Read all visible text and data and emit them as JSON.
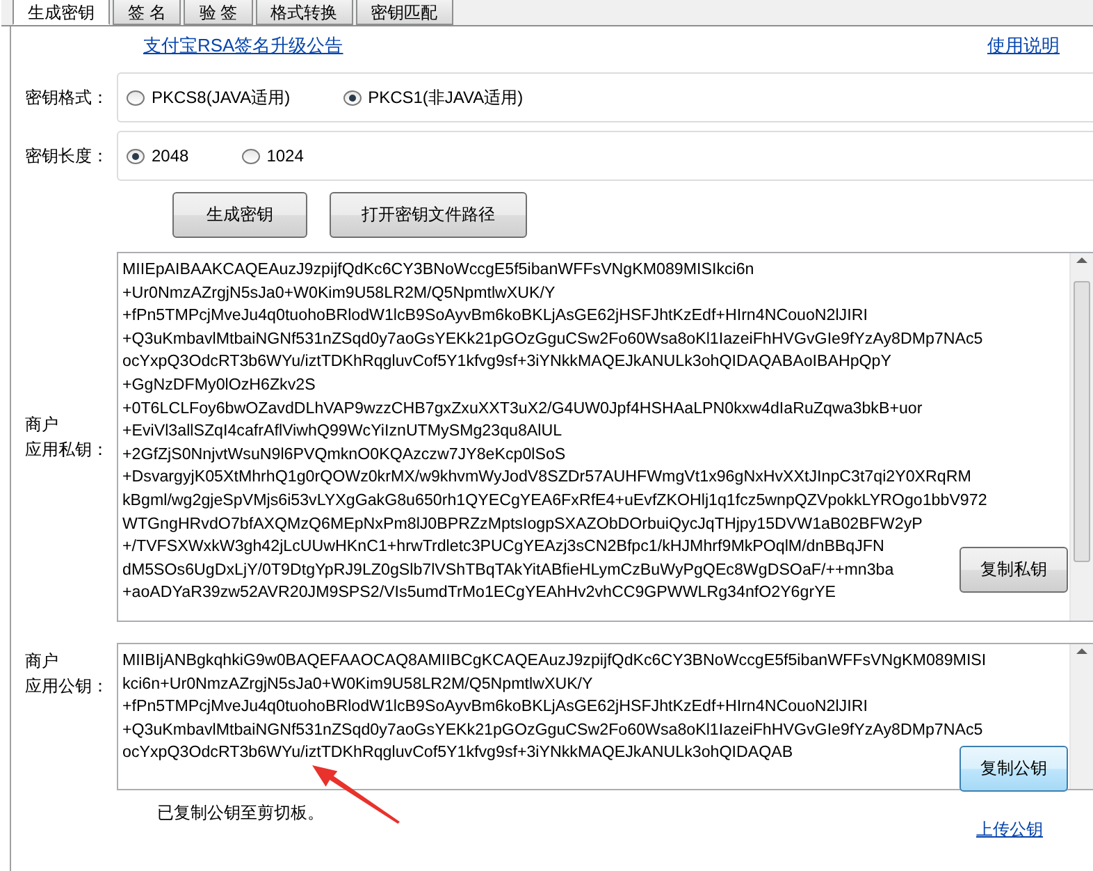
{
  "tabs": [
    {
      "label": "生成密钥",
      "selected": true
    },
    {
      "label": "签 名",
      "selected": false
    },
    {
      "label": "验 签",
      "selected": false
    },
    {
      "label": "格式转换",
      "selected": false
    },
    {
      "label": "密钥匹配",
      "selected": false
    }
  ],
  "notice_link": "支付宝RSA签名升级公告",
  "help_link": "使用说明",
  "key_format": {
    "label": "密钥格式：",
    "options": [
      {
        "label": "PKCS8(JAVA适用)",
        "selected": false
      },
      {
        "label": "PKCS1(非JAVA适用)",
        "selected": true
      }
    ]
  },
  "key_length": {
    "label": "密钥长度：",
    "options": [
      {
        "label": "2048",
        "selected": true
      },
      {
        "label": "1024",
        "selected": false
      }
    ]
  },
  "buttons": [
    "生成密钥",
    "打开密钥文件路径"
  ],
  "private_key": {
    "label": [
      "商户",
      "应用私钥："
    ],
    "copy_button": "复制私钥",
    "lines": [
      "MIIEpAIBAAKCAQEAuzJ9zpijfQdKc6CY3BNoWccgE5f5ibanWFFsVNgKM089MISIkci6n",
      "+Ur0NmzAZrgjN5sJa0+W0Kim9U58LR2M/Q5NpmtlwXUK/Y",
      "+fPn5TMPcjMveJu4q0tuohoBRlodW1lcB9SoAyvBm6koBKLjAsGE62jHSFJhtKzEdf+HIrn4NCouoN2lJIRI",
      "+Q3uKmbavlMtbaiNGNf531nZSqd0y7aoGsYEKk21pGOzGguCSw2Fo60Wsa8oKl1IazeiFhHVGvGIe9fYzAy8DMp7NAc5",
      "ocYxpQ3OdcRT3b6WYu/iztTDKhRqgluvCof5Y1kfvg9sf+3iYNkkMAQEJkANULk3ohQIDAQABAoIBAHpQpY",
      "+GgNzDFMy0lOzH6Zkv2S",
      "+0T6LCLFoy6bwOZavdDLhVAP9wzzCHB7gxZxuXXT3uX2/G4UW0Jpf4HSHAaLPN0kxw4dIaRuZqwa3bkB+uor",
      "+EviVl3allSZqI4cafrAflViwhQ99WcYiIznUTMySMg23qu8AlUL",
      "+2GfZjS0NnjvtWsuN9l6PVQmknO0KQAzczw7JY8eKcp0lSoS",
      "+DsvargyjK05XtMhrhQ1g0rQOWz0krMX/w9khvmWyJodV8SZDr57AUHFWmgVt1x96gNxHvXXtJInpC3t7qi2Y0XRqRM",
      "kBgml/wg2gjeSpVMjs6i53vLYXgGakG8u650rh1QYECgYEA6FxRfE4+uEvfZKOHlj1q1fcz5wnpQZVpokkLYROgo1bbV972",
      "WTGngHRvdO7bfAXQMzQ6MEpNxPm8lJ0BPRZzMptsIogpSXAZObDOrbuiQycJqTHjpy15DVW1aB02BFW2yP",
      "+/TVFSXWxkW3gh42jLcUUwHKnC1+hrwTrdletc3PUCgYEAzj3sCN2Bfpc1/kHJMhrf9MkPOqlM/dnBBqJFN",
      "dM5SOs6UgDxLjY/0T9DtgYpRJ9LZ0gSlb7lVShTBqTAkYitABfieHLymCzBuWyPgQEc8WgDSOaF/++mn3ba",
      "+aoADYaR39zw52AVR20JM9SPS2/VIs5umdTrMo1ECgYEAhHv2vhCC9GPWWLRg34nfO2Y6grYE"
    ]
  },
  "public_key": {
    "label": [
      "商户",
      "应用公钥："
    ],
    "copy_button": "复制公钥",
    "lines": [
      "MIIBIjANBgkqhkiG9w0BAQEFAAOCAQ8AMIIBCgKCAQEAuzJ9zpijfQdKc6CY3BNoWccgE5f5ibanWFFsVNgKM089MISI",
      "kci6n+Ur0NmzAZrgjN5sJa0+W0Kim9U58LR2M/Q5NpmtlwXUK/Y",
      "+fPn5TMPcjMveJu4q0tuohoBRlodW1lcB9SoAyvBm6koBKLjAsGE62jHSFJhtKzEdf+HIrn4NCouoN2lJIRI",
      "+Q3uKmbavlMtbaiNGNf531nZSqd0y7aoGsYEKk21pGOzGguCSw2Fo60Wsa8oKl1IazeiFhHVGvGIe9fYzAy8DMp7NAc5",
      "ocYxpQ3OdcRT3b6WYu/iztTDKhRqgluvCof5Y1kfvg9sf+3iYNkkMAQEJkANULk3ohQIDAQAB"
    ]
  },
  "status_message": "已复制公钥至剪切板。",
  "upload_link": "上传公钥"
}
